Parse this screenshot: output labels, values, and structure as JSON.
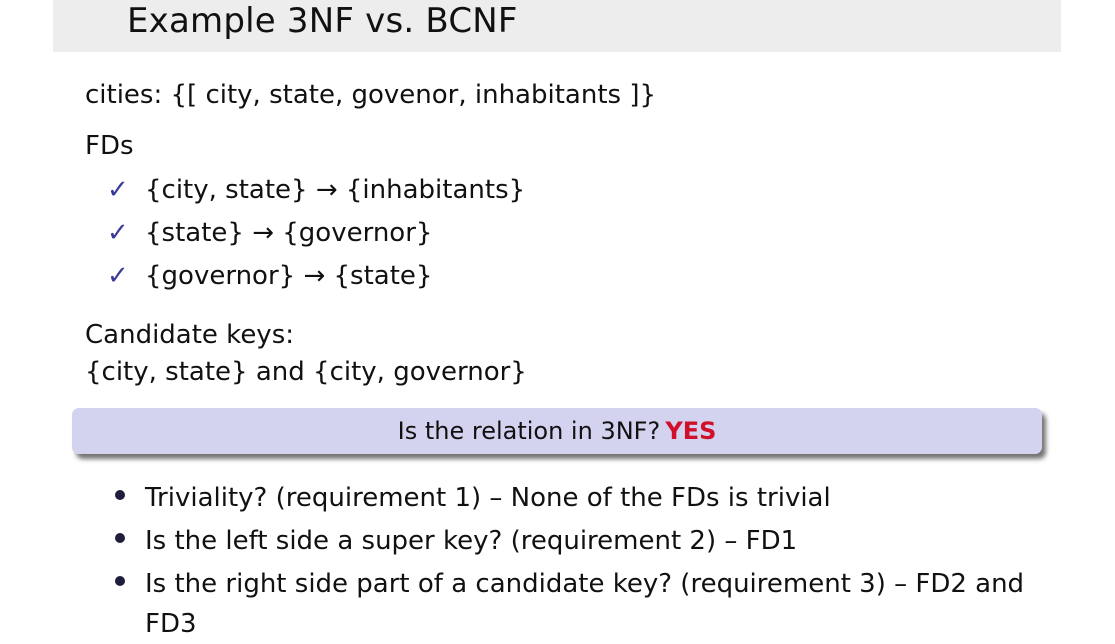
{
  "slide": {
    "title": "Example 3NF vs. BCNF",
    "schema": "cities: {[ city, state, govenor, inhabitants ]}",
    "fds_heading": "FDs",
    "check_symbol": "✓",
    "fds": [
      "{city, state} → {inhabitants}",
      "{state} → {governor}",
      "{governor} → {state}"
    ],
    "candidate_keys_label": "Candidate keys:",
    "candidate_keys": "{city, state} and {city, governor}",
    "question": "Is the relation in 3NF?",
    "answer": "YES",
    "bullets": [
      "Triviality? (requirement 1) – None of the FDs is trivial",
      "Is the left side a super key? (requirement 2) – FD1",
      "Is the right side part of a candidate key? (requirement 3) – FD2 and FD3"
    ],
    "colors": {
      "title_bar": "#ededed",
      "box": "#d3d3f0",
      "answer": "#d0102a",
      "check": "#3a3a9a"
    }
  }
}
